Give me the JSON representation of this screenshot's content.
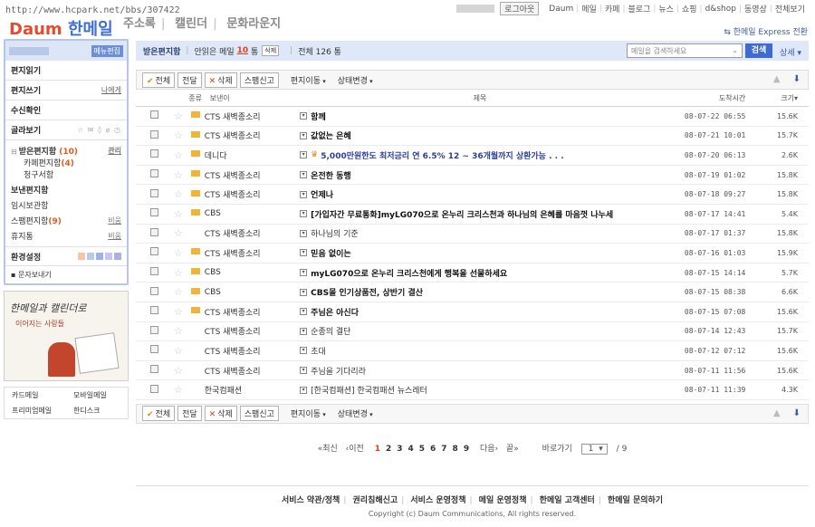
{
  "browser": {
    "url": "http://www.hcpark.net/bbs/307422"
  },
  "app": {
    "logo_daum": "Daum",
    "logo_mail": "한메일",
    "nav": [
      "주소록",
      "캘린더",
      "문화라운지"
    ],
    "express_link": "한메일 Express 전환"
  },
  "topbar": {
    "logout": "로그아웃",
    "links": [
      "Daum",
      "메일",
      "카페",
      "블로그",
      "뉴스",
      "쇼핑",
      "d&shop",
      "동영상",
      "전체보기"
    ]
  },
  "sidebar": {
    "menu_edit": "메뉴편집",
    "actions": [
      {
        "label": "편지읽기"
      },
      {
        "label": "편지쓰기",
        "sub": "나에게"
      },
      {
        "label": "수신확인"
      },
      {
        "label": "골라보기",
        "icons": "☆ ✉ ◊ ⌀ ◷"
      }
    ],
    "folders": [
      {
        "label": "받은편지함",
        "count": "(10)",
        "action": "관리",
        "bold": true,
        "expander": "⊟"
      },
      {
        "label": "카페편지함",
        "count": "(4)",
        "indent": true
      },
      {
        "label": "청구서함",
        "indent": true
      },
      {
        "label": "보낸편지함",
        "bold": true
      },
      {
        "label": "임시보관함"
      },
      {
        "label": "스팸편지함",
        "count": "(9)",
        "action": "비움"
      },
      {
        "label": "휴지통",
        "action": "비움"
      }
    ],
    "settings": "환경설정",
    "swatch_colors": [
      "#f7c6a8",
      "#b8c8f0",
      "#9fb2e8",
      "#c6c6f0",
      "#b0b0e0"
    ],
    "send_text": "문자보내기",
    "banner_text": "한메일과 캘린더로",
    "banner_sub": "이어지는 사랑들",
    "links": [
      "카드메일",
      "모바일메일",
      "프리미엄메일",
      "한디스크"
    ]
  },
  "status": {
    "folder": "받은편지함",
    "unread_label": "안읽은 메일",
    "unread_count": "10",
    "unread_unit": "통",
    "delete_btn": "삭제",
    "total": "전체 126 통",
    "search_placeholder": "메일을 검색하세요",
    "search_btn": "검색",
    "detail": "상세"
  },
  "toolbar": {
    "all": "전체",
    "forward": "전달",
    "delete": "삭제",
    "spam": "스팸신고",
    "move": "편지이동",
    "status_change": "상태변경"
  },
  "columns": {
    "type": "종류",
    "sender": "보낸이",
    "title": "제목",
    "date": "도착시간",
    "size": "크기"
  },
  "mails": [
    {
      "sender": "CTS 새벽종소리",
      "title": "함께",
      "date": "08-07-22 06:55",
      "size": "15.6K",
      "unread": true
    },
    {
      "sender": "CTS 새벽종소리",
      "title": "값없는 은혜",
      "date": "08-07-21 10:01",
      "size": "15.7K",
      "unread": true
    },
    {
      "sender": "데니다",
      "title": "5,000만원한도 최저금리 연 6.5% 12 ~ 36개월까지 상환가능 . . .",
      "date": "08-07-20 06:13",
      "size": "2.6K",
      "unread": true,
      "ad": true
    },
    {
      "sender": "CTS 새벽종소리",
      "title": "온전한 동행",
      "date": "08-07-19 01:02",
      "size": "15.8K",
      "unread": true
    },
    {
      "sender": "CTS 새벽종소리",
      "title": "언제나",
      "date": "08-07-18 09:27",
      "size": "15.8K",
      "unread": true
    },
    {
      "sender": "CBS",
      "title": "[가입자간 무료통화]myLG070으로 온누리 크리스천과 하나님의 은혜를 마음껏 나누세",
      "date": "08-07-17 14:41",
      "size": "5.4K",
      "unread": true
    },
    {
      "sender": "CTS 새벽종소리",
      "title": "하나님의 기준",
      "date": "08-07-17 01:37",
      "size": "15.8K",
      "unread": false
    },
    {
      "sender": "CTS 새벽종소리",
      "title": "믿음 없이는",
      "date": "08-07-16 01:03",
      "size": "15.9K",
      "unread": true
    },
    {
      "sender": "CBS",
      "title": "myLG070으로 온누리 크리스천에게 행복을 선물하세요",
      "date": "08-07-15 14:14",
      "size": "5.7K",
      "unread": true
    },
    {
      "sender": "CBS",
      "title": "CBS몰 인기상품전, 상반기 결산",
      "date": "08-07-15 08:38",
      "size": "6.6K",
      "unread": true
    },
    {
      "sender": "CTS 새벽종소리",
      "title": "주님은 아신다",
      "date": "08-07-15 07:08",
      "size": "15.6K",
      "unread": true
    },
    {
      "sender": "CTS 새벽종소리",
      "title": "순종의 결단",
      "date": "08-07-14 12:43",
      "size": "15.7K",
      "unread": false
    },
    {
      "sender": "CTS 새벽종소리",
      "title": "초대",
      "date": "08-07-12 07:12",
      "size": "15.6K",
      "unread": false
    },
    {
      "sender": "CTS 새벽종소리",
      "title": "주님을 기다리라",
      "date": "08-07-11 11:56",
      "size": "15.6K",
      "unread": false
    },
    {
      "sender": "한국컴패션",
      "title": "[한국컴패션] 한국컴패션 뉴스레터",
      "date": "08-07-11 11:39",
      "size": "4.3K",
      "unread": false
    }
  ],
  "pager": {
    "first": "«최신",
    "prev": "‹이전",
    "pages": [
      "1",
      "2",
      "3",
      "4",
      "5",
      "6",
      "7",
      "8",
      "9"
    ],
    "current": "1",
    "next": "다음›",
    "last": "끝»",
    "goto": "바로가기",
    "goto_value": "1",
    "total": "/ 9"
  },
  "footer": {
    "links": [
      "서비스 약관/정책",
      "권리침해신고",
      "서비스 운영정책",
      "메일 운영정책",
      "한메일 고객센터",
      "한메일 문의하기"
    ],
    "copyright": "Copyright (c) Daum Communications, All rights reserved."
  }
}
